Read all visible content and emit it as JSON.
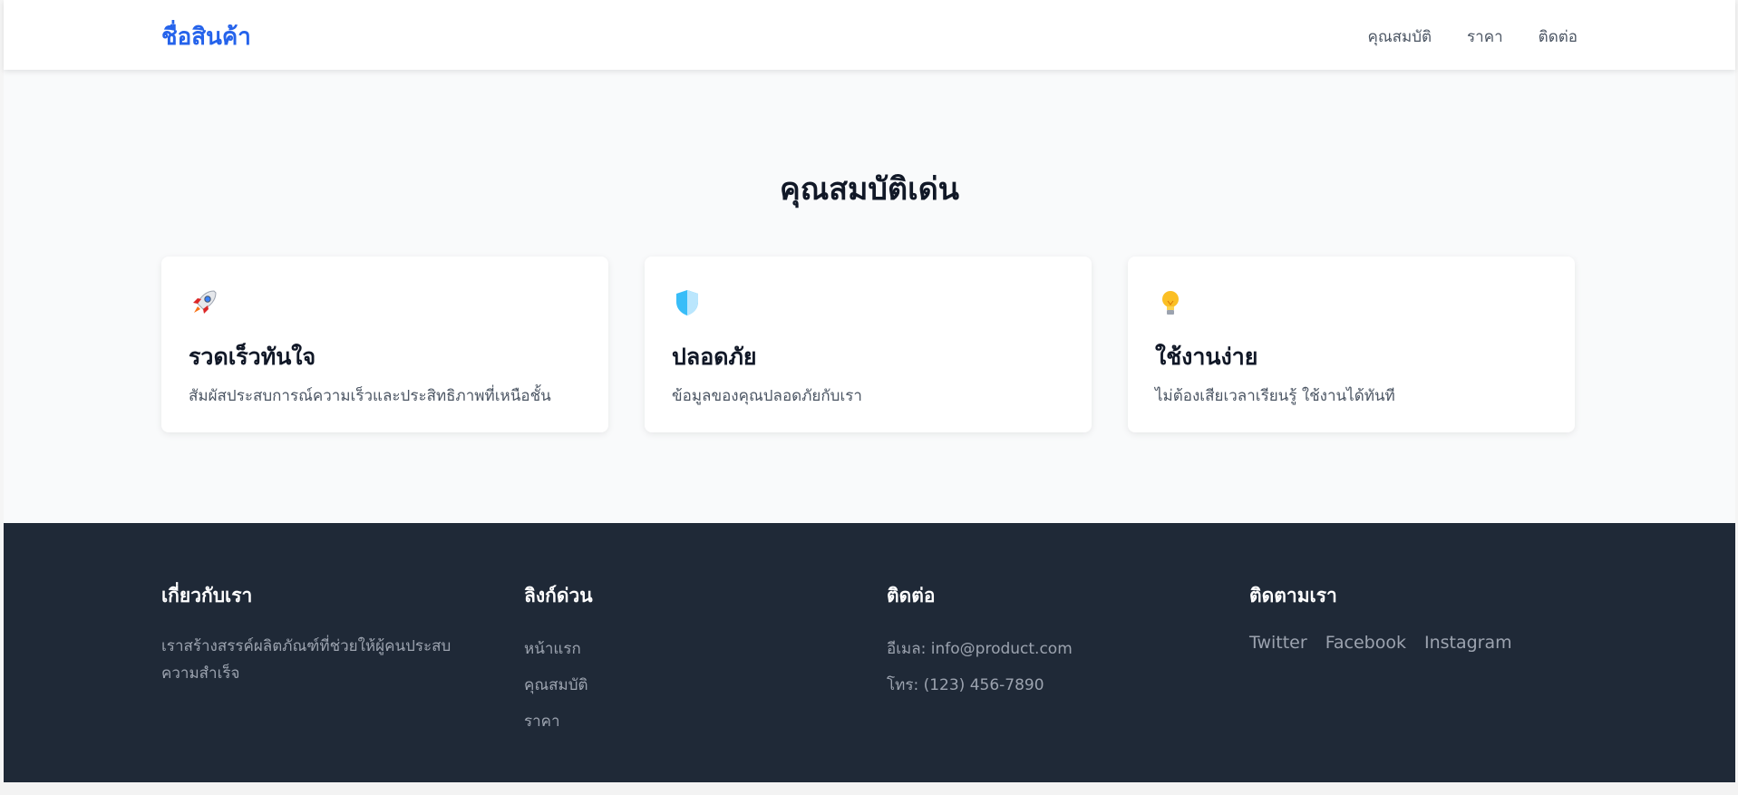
{
  "header": {
    "brand": "ชื่อสินค้า",
    "nav": [
      "คุณสมบัติ",
      "ราคา",
      "ติดต่อ"
    ]
  },
  "features": {
    "title": "คุณสมบัติเด่น",
    "cards": [
      {
        "icon": "rocket-icon",
        "title": "รวดเร็วทันใจ",
        "desc": "สัมผัสประสบการณ์ความเร็วและประสิทธิภาพที่เหนือชั้น"
      },
      {
        "icon": "shield-icon",
        "title": "ปลอดภัย",
        "desc": "ข้อมูลของคุณปลอดภัยกับเรา"
      },
      {
        "icon": "lightbulb-icon",
        "title": "ใช้งานง่าย",
        "desc": "ไม่ต้องเสียเวลาเรียนรู้ ใช้งานได้ทันที"
      }
    ]
  },
  "footer": {
    "about": {
      "title": "เกี่ยวกับเรา",
      "text": "เราสร้างสรรค์ผลิตภัณฑ์ที่ช่วยให้ผู้คนประสบความสำเร็จ"
    },
    "quick_links": {
      "title": "ลิงก์ด่วน",
      "items": [
        "หน้าแรก",
        "คุณสมบัติ",
        "ราคา"
      ]
    },
    "contact": {
      "title": "ติดต่อ",
      "email": "อีเมล: info@product.com",
      "phone": "โทร: (123) 456-7890"
    },
    "follow": {
      "title": "ติดตามเรา",
      "items": [
        "Twitter",
        "Facebook",
        "Instagram"
      ]
    }
  },
  "colors": {
    "brand": "#2563eb",
    "footer_bg": "#1f2937",
    "page_bg": "#f9fafb"
  }
}
